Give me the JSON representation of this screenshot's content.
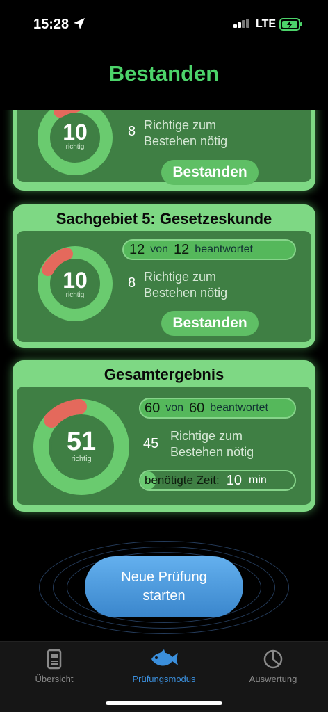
{
  "status": {
    "time": "15:28",
    "network": "LTE"
  },
  "page_title": "Bestanden",
  "cards": [
    {
      "title": "",
      "correct": "10",
      "correct_label": "richtig",
      "needed": "8",
      "needed_text_1": "Richtige zum",
      "needed_text_2": "Bestehen nötig",
      "badge": "Bestanden"
    },
    {
      "title": "Sachgebiet 5: Gesetzeskunde",
      "answered": "12",
      "of_word": "von",
      "total": "12",
      "answered_word": "beantwortet",
      "correct": "10",
      "correct_label": "richtig",
      "needed": "8",
      "needed_text_1": "Richtige zum",
      "needed_text_2": "Bestehen nötig",
      "badge": "Bestanden"
    }
  ],
  "total_card": {
    "title": "Gesamtergebnis",
    "answered": "60",
    "of_word": "von",
    "total": "60",
    "answered_word": "beantwortet",
    "correct": "51",
    "correct_label": "richtig",
    "needed": "45",
    "needed_text_1": "Richtige zum",
    "needed_text_2": "Bestehen nötig",
    "time_label": "benötigte Zeit:",
    "time_value": "10",
    "time_unit": "min",
    "time_progress": 0.1
  },
  "start_button": {
    "line1": "Neue Prüfung",
    "line2": "starten"
  },
  "tabs": [
    {
      "label": "Übersicht",
      "icon": "document-icon",
      "active": false
    },
    {
      "label": "Prüfungsmodus",
      "icon": "fish-icon",
      "active": true
    },
    {
      "label": "Auswertung",
      "icon": "pie-chart-icon",
      "active": false
    }
  ],
  "colors": {
    "accent_green": "#4cd36a",
    "card_green": "#7ed884",
    "inner_green": "#3f7f44",
    "wrong_red": "#e4695c",
    "tab_active": "#3b8fdc"
  }
}
